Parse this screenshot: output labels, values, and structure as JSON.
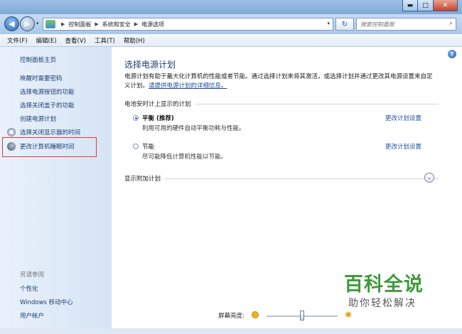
{
  "window": {
    "min_symbol": "▬",
    "max_symbol": "□",
    "close_symbol": "✕"
  },
  "nav": {
    "back_symbol": "◀",
    "forward_symbol": "▶",
    "dropdown_symbol": "▾",
    "breadcrumbs": [
      "控制面板",
      "系统和安全",
      "电源选项"
    ],
    "refresh_symbol": "↻"
  },
  "search": {
    "placeholder": "搜索控制面板",
    "icon": "search-icon"
  },
  "menubar": {
    "items": [
      "文件(F)",
      "编辑(E)",
      "查看(V)",
      "工具(T)",
      "帮助(H)"
    ]
  },
  "sidebar": {
    "home": "控制面板主页",
    "links": [
      "唤醒时需要密码",
      "选择电源按钮的功能",
      "选择关闭盖子的功能",
      "创建电源计划",
      "选择关闭显示器的时间",
      "更改计算机睡眠时间"
    ],
    "see_also_title": "另请参阅",
    "see_also": [
      "个性化",
      "Windows 移动中心",
      "用户帐户"
    ]
  },
  "main": {
    "title": "选择电源计划",
    "intro_text": "电源计划有助于最大化计算机的性能或者节能。通过选择计划来将其激活，或选择计划并通过更改其电源设置来自定义计划。",
    "intro_link": "请提供电源计划的详细信息。",
    "section_battery": "电池安时计上显示的计划",
    "plans": [
      {
        "name": "平衡 (推荐)",
        "description": "利用可用的硬件自动平衡功耗与性能。",
        "selected": true,
        "link": "更改计划设置"
      },
      {
        "name": "节能",
        "description": "尽可能降低计算机性能以节能。",
        "selected": false,
        "link": "更改计划设置"
      }
    ],
    "section_more": "显示附加计划",
    "expander_symbol": "⌄",
    "brightness_label": "屏幕亮度:",
    "brightness_level": 0.5,
    "help_symbol": "?"
  },
  "watermark": {
    "main": "百科全说",
    "sub": "助你轻松解决"
  },
  "colors": {
    "link": "#1f4f9a",
    "title": "#1e3c74",
    "highlight": "#e2393b",
    "watermark": "#3f9a3a"
  }
}
